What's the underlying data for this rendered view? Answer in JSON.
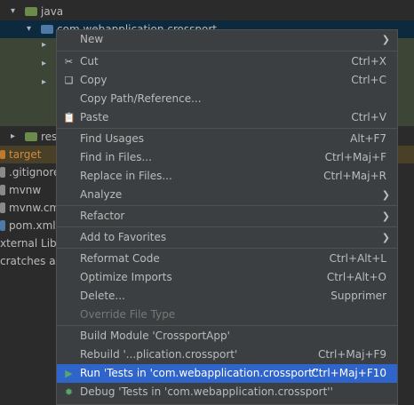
{
  "tree": {
    "items": [
      {
        "label": "java"
      },
      {
        "label": "com.webapplication.crossport"
      },
      {
        "label": "reso"
      },
      {
        "label": "target"
      },
      {
        "label": ".gitignore"
      },
      {
        "label": "mvnw"
      },
      {
        "label": "mvnw.cmd"
      },
      {
        "label": "pom.xml"
      },
      {
        "label": "xternal Librar"
      },
      {
        "label": "cratches and"
      }
    ]
  },
  "menu": {
    "new": {
      "label": "New"
    },
    "cut": {
      "label": "Cut",
      "shortcut": "Ctrl+X"
    },
    "copy": {
      "label": "Copy",
      "shortcut": "Ctrl+C"
    },
    "copy_path": {
      "label": "Copy Path/Reference..."
    },
    "paste": {
      "label": "Paste",
      "shortcut": "Ctrl+V"
    },
    "find_usages": {
      "label": "Find Usages",
      "shortcut": "Alt+F7"
    },
    "find_in_files": {
      "label": "Find in Files...",
      "shortcut": "Ctrl+Maj+F"
    },
    "replace_in_files": {
      "label": "Replace in Files...",
      "shortcut": "Ctrl+Maj+R"
    },
    "analyze": {
      "label": "Analyze"
    },
    "refactor": {
      "label": "Refactor"
    },
    "add_to_favorites": {
      "label": "Add to Favorites"
    },
    "reformat_code": {
      "label": "Reformat Code",
      "shortcut": "Ctrl+Alt+L"
    },
    "optimize_imports": {
      "label": "Optimize Imports",
      "shortcut": "Ctrl+Alt+O"
    },
    "delete": {
      "label": "Delete...",
      "shortcut": "Supprimer"
    },
    "override_file_type": {
      "label": "Override File Type"
    },
    "build_module": {
      "label": "Build Module 'CrossportApp'"
    },
    "rebuild": {
      "label": "Rebuild '...plication.crossport'",
      "shortcut": "Ctrl+Maj+F9"
    },
    "run_tests": {
      "label": "Run 'Tests in 'com.webapplication.crossport''",
      "shortcut": "Ctrl+Maj+F10"
    },
    "debug_tests": {
      "label": "Debug 'Tests in 'com.webapplication.crossport''"
    }
  },
  "colors": {
    "menu_bg": "#3c3f41",
    "highlight": "#2f65ca",
    "run_icon": "#59a869",
    "debug_icon": "#59a869"
  }
}
